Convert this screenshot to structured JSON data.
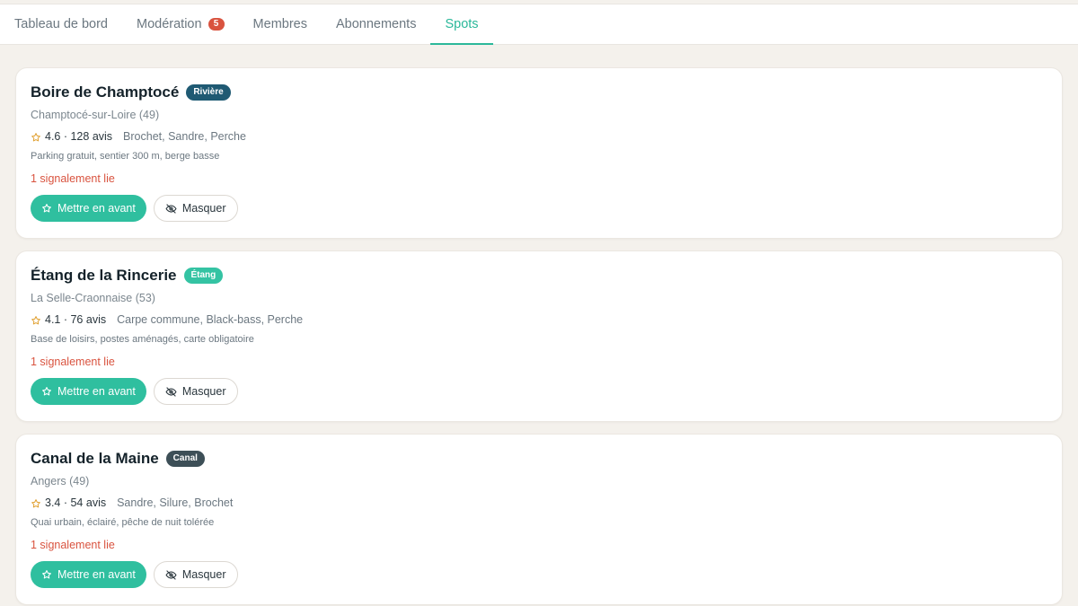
{
  "tabs": [
    {
      "label": "Tableau de bord",
      "active": false
    },
    {
      "label": "Modération",
      "badge": "5",
      "active": false
    },
    {
      "label": "Membres",
      "active": false
    },
    {
      "label": "Abonnements",
      "active": false
    },
    {
      "label": "Spots",
      "active": true
    }
  ],
  "colors": {
    "accent": "#2bb89a",
    "danger": "#d9533f",
    "badge_riviere": "#1f5a73",
    "badge_etang": "#34c3a3",
    "badge_canal": "#3d4f57"
  },
  "spots": [
    {
      "name": "Boire de Champtocé",
      "type": "Rivière",
      "location": "Champtocé-sur-Loire (49)",
      "rating": "4.6 · 128 avis",
      "species": "Brochet, Sandre, Perche",
      "description": "Parking gratuit, sentier 300 m, berge basse",
      "reports": "1 signalement lie",
      "feature_label": "Mettre en avant",
      "hide_label": "Masquer"
    },
    {
      "name": "Étang de la Rincerie",
      "type": "Étang",
      "location": "La Selle-Craonnaise (53)",
      "rating": "4.1 · 76 avis",
      "species": "Carpe commune, Black-bass, Perche",
      "description": "Base de loisirs, postes aménagés, carte obligatoire",
      "reports": "1 signalement lie",
      "feature_label": "Mettre en avant",
      "hide_label": "Masquer"
    },
    {
      "name": "Canal de la Maine",
      "type": "Canal",
      "location": "Angers (49)",
      "rating": "3.4 · 54 avis",
      "species": "Sandre, Silure, Brochet",
      "description": "Quai urbain, éclairé, pêche de nuit tolérée",
      "reports": "1 signalement lie",
      "feature_label": "Mettre en avant",
      "hide_label": "Masquer"
    }
  ]
}
